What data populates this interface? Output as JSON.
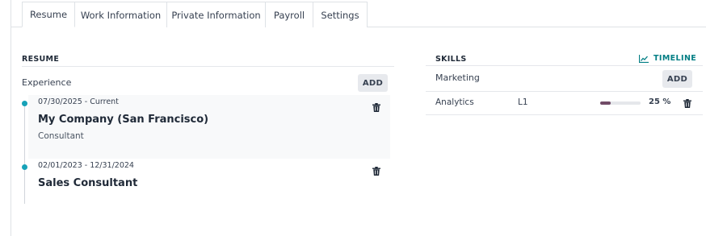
{
  "tabs": [
    {
      "label": "Resume"
    },
    {
      "label": "Work Information"
    },
    {
      "label": "Private Information"
    },
    {
      "label": "Payroll"
    },
    {
      "label": "Settings"
    }
  ],
  "resume": {
    "title": "RESUME",
    "group_label": "Experience",
    "add_label": "ADD",
    "entries": [
      {
        "date": "07/30/2025 - Current",
        "title": "My Company (San Francisco)",
        "subtitle": "Consultant"
      },
      {
        "date": "02/01/2023 - 12/31/2024",
        "title": "Sales Consultant",
        "subtitle": ""
      }
    ]
  },
  "skills": {
    "title": "SKILLS",
    "timeline_label": "TIMELINE",
    "group_label": "Marketing",
    "add_label": "ADD",
    "rows": [
      {
        "name": "Analytics",
        "level": "L1",
        "progress_text": "25 %",
        "progress": 0.25
      }
    ]
  },
  "colors": {
    "accent": "#017e84",
    "dot": "#17a2b8",
    "progress": "#714B67"
  }
}
